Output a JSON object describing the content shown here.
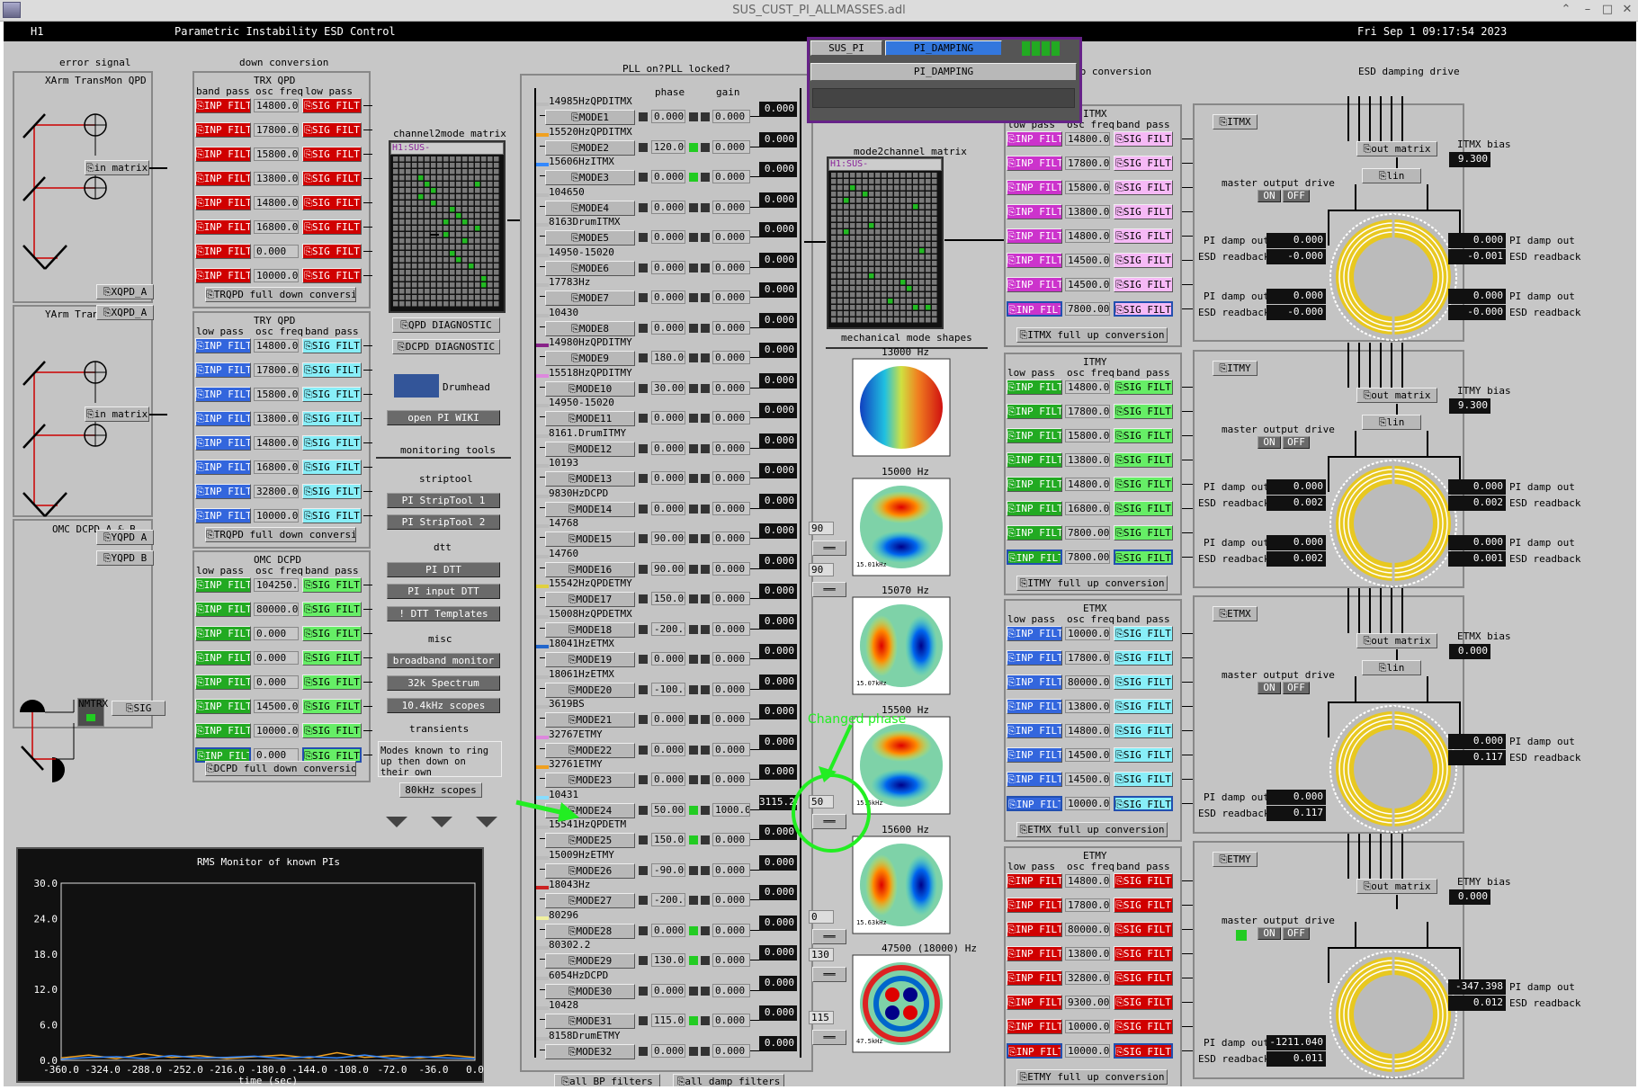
{
  "window_title": "SUS_CUST_PI_ALLMASSES.adl",
  "header": {
    "ifo": "H1",
    "title": "Parametric Instability ESD Control",
    "datetime": "Fri Sep  1 09:17:54 2023"
  },
  "colors": {
    "background": "#c7c7c7",
    "alarm_red": "#d00000",
    "damp_green": "#22aa22",
    "esd_ring": "#f0d020",
    "popup_border": "#662288",
    "annotation": "#22ee22"
  },
  "popup": {
    "tab1": "SUS_PI",
    "tab2": "PI_DAMPING",
    "menu": "PI_DAMPING"
  },
  "error_signal": {
    "title": "error signal",
    "xarm_title": "XArm TransMon QPD",
    "xarm_in_matrix": "in matrix",
    "xqpd_a": "XQPD_A",
    "xqpd_b": "XQPD_A",
    "yarm_title": "YArm TransMon QPD",
    "yarm_in_matrix": "in matrix",
    "yqpd_a": "YQPD A",
    "yqpd_b": "YQPD B",
    "omc_title": "OMC DCPD A & B",
    "nmtrx": "NMTRX",
    "sig": "SIG"
  },
  "down_conversion": {
    "title": "down conversion",
    "trx": {
      "title": "TRX QPD",
      "col_a": "band pass",
      "col_b": "osc freq",
      "col_c": "low pass",
      "inp_label": "INP FILT",
      "sig_label": "SIG FILT",
      "freqs": [
        "14800.0",
        "17800.0",
        "15800.0",
        "13800.0",
        "14800.0",
        "16800.0",
        "0.000",
        "10000.0"
      ],
      "full_label": "TRQPD full down conversion"
    },
    "try": {
      "title": "TRY QPD",
      "col_a": "low pass",
      "col_b": "osc freq",
      "col_c": "band pass",
      "inp_label": "INP FILT",
      "sig_label": "SIG FILT",
      "freqs": [
        "14800.0",
        "17800.0",
        "15800.0",
        "13800.0",
        "14800.0",
        "16800.0",
        "32800.0",
        "10000.0"
      ],
      "full_label": "TRQPD full down conversion"
    },
    "omc": {
      "title": "OMC DCPD",
      "col_a": "low pass",
      "col_b": "osc freq",
      "col_c": "band pass",
      "inp_label": "INP FILT",
      "sig_label": "SIG FILT",
      "freqs": [
        "104250.",
        "80000.0",
        "0.000",
        "0.000",
        "0.000",
        "14500.0",
        "10000.0",
        "0.000"
      ],
      "full_label": "DCPD full down conversion"
    }
  },
  "channel2mode": {
    "title": "channel2mode matrix",
    "pv": "H1:SUS-PI_PROC_CHNL2MODE_MTRX"
  },
  "tools": {
    "qpd_diag": "QPD DIAGNOSTIC",
    "dcpd_diag": "DCPD DIAGNOSTIC",
    "drumhead": "Drumhead",
    "wiki": "open PI WIKI",
    "monitoring": "monitoring tools",
    "striptool": "striptool",
    "st1": "PI StripTool 1",
    "st2": "PI StripTool 2",
    "dtt": "dtt",
    "pi_dtt": "PI DTT",
    "pi_input_dtt": "PI input DTT",
    "dtt_templates": "! DTT Templates",
    "misc": "misc",
    "broadband": "broadband monitor",
    "spectrum": "32k Spectrum",
    "scopes10": "10.4kHz scopes",
    "transients": "transients",
    "note": "Modes known to ring up then down on their own",
    "scopes80": "80kHz scopes"
  },
  "modes_header": {
    "pll_on": "PLL on?",
    "pll_locked": "PLL locked?",
    "phase": "phase",
    "gain": "gain"
  },
  "modes": [
    {
      "freq": "14985HzQPDITMX",
      "name": "MODE1",
      "phase": "0.000",
      "gain": "0.000",
      "out": "0.000",
      "color": "#bbbbbb",
      "locked": false
    },
    {
      "freq": "15520HzQPDITMX",
      "name": "MODE2",
      "phase": "120.00",
      "gain": "0.000",
      "out": "0.000",
      "color": "#f0a020",
      "locked": true
    },
    {
      "freq": "15606HzITMX",
      "name": "MODE3",
      "phase": "0.000",
      "gain": "0.000",
      "out": "0.000",
      "color": "#3388ff",
      "locked": true
    },
    {
      "freq": "104650",
      "name": "MODE4",
      "phase": "0.000",
      "gain": "0.000",
      "out": "0.000",
      "color": "#bbbbbb",
      "locked": false
    },
    {
      "freq": "8163DrumITMX",
      "name": "MODE5",
      "phase": "0.000",
      "gain": "0.000",
      "out": "0.000",
      "color": "#bbbbbb",
      "locked": false
    },
    {
      "freq": "14950-15020",
      "name": "MODE6",
      "phase": "0.000",
      "gain": "0.000",
      "out": "0.000",
      "color": "#bbbbbb",
      "locked": false
    },
    {
      "freq": "17783Hz",
      "name": "MODE7",
      "phase": "0.000",
      "gain": "0.000",
      "out": "0.000",
      "color": "#bbbbbb",
      "locked": false
    },
    {
      "freq": "10430",
      "name": "MODE8",
      "phase": "0.000",
      "gain": "0.000",
      "out": "0.000",
      "color": "#bbbbbb",
      "locked": false
    },
    {
      "freq": "14980HzQPDITMY",
      "name": "MODE9",
      "phase": "180.00",
      "gain": "0.000",
      "out": "0.000",
      "color": "#882288",
      "locked": false
    },
    {
      "freq": "15518HzQPDITMY",
      "name": "MODE10",
      "phase": "30.000",
      "gain": "0.000",
      "out": "0.000",
      "color": "#dd88dd",
      "locked": false
    },
    {
      "freq": "14950-15020",
      "name": "MODE11",
      "phase": "0.000",
      "gain": "0.000",
      "out": "0.000",
      "color": "#bbbbbb",
      "locked": false
    },
    {
      "freq": "8161.DrumITMY",
      "name": "MODE12",
      "phase": "0.000",
      "gain": "0.000",
      "out": "0.000",
      "color": "#bbbbbb",
      "locked": false
    },
    {
      "freq": "10193",
      "name": "MODE13",
      "phase": "0.000",
      "gain": "0.000",
      "out": "0.000",
      "color": "#bbbbbb",
      "locked": false
    },
    {
      "freq": "9830HzDCPD",
      "name": "MODE14",
      "phase": "0.000",
      "gain": "0.000",
      "out": "0.000",
      "color": "#bbbbbb",
      "locked": false
    },
    {
      "freq": "14768",
      "name": "MODE15",
      "phase": "90.000",
      "gain": "0.000",
      "out": "0.000",
      "color": "#bbbbbb",
      "locked": false
    },
    {
      "freq": "14760",
      "name": "MODE16",
      "phase": "90.000",
      "gain": "0.000",
      "out": "0.000",
      "color": "#bbbbbb",
      "locked": false
    },
    {
      "freq": "15542HzQPDETMY",
      "name": "MODE17",
      "phase": "150.00",
      "gain": "0.000",
      "out": "0.000",
      "color": "#e0d040",
      "locked": false
    },
    {
      "freq": "15008HzQPDETMX",
      "name": "MODE18",
      "phase": "-200.0",
      "gain": "0.000",
      "out": "0.000",
      "color": "#bbbbbb",
      "locked": false
    },
    {
      "freq": "18041HzETMX",
      "name": "MODE19",
      "phase": "0.000",
      "gain": "0.000",
      "out": "0.000",
      "color": "#2266cc",
      "locked": false
    },
    {
      "freq": "18061HzETMX",
      "name": "MODE20",
      "phase": "-100.0",
      "gain": "0.000",
      "out": "0.000",
      "color": "#bbbbbb",
      "locked": false
    },
    {
      "freq": "3619BS",
      "name": "MODE21",
      "phase": "0.000",
      "gain": "0.000",
      "out": "0.000",
      "color": "#bbbbbb",
      "locked": false
    },
    {
      "freq": "32767ETMY",
      "name": "MODE22",
      "phase": "0.000",
      "gain": "0.000",
      "out": "0.000",
      "color": "#dd88dd",
      "locked": false
    },
    {
      "freq": "32761ETMY",
      "name": "MODE23",
      "phase": "0.000",
      "gain": "0.000",
      "out": "0.000",
      "color": "#f0a020",
      "locked": false
    },
    {
      "freq": "10431",
      "name": "MODE24",
      "phase": "50.000",
      "gain": "1000.00",
      "out": "3115.22",
      "color": "#88ddff",
      "locked": true
    },
    {
      "freq": "15541HzQPDETM",
      "name": "MODE25",
      "phase": "150.00",
      "gain": "0.000",
      "out": "0.000",
      "color": "#bbbbbb",
      "locked": true
    },
    {
      "freq": "15009HzETMY",
      "name": "MODE26",
      "phase": "-90.000",
      "gain": "0.000",
      "out": "0.000",
      "color": "#bbbbbb",
      "locked": false
    },
    {
      "freq": "18043Hz",
      "name": "MODE27",
      "phase": "-200.0",
      "gain": "0.000",
      "out": "0.000",
      "color": "#cc2222",
      "locked": false
    },
    {
      "freq": "80296",
      "name": "MODE28",
      "phase": "0.000",
      "gain": "0.000",
      "out": "0.000",
      "color": "#f0f0a0",
      "locked": true
    },
    {
      "freq": "80302.2",
      "name": "MODE29",
      "phase": "130.00",
      "gain": "0.000",
      "out": "0.000",
      "color": "#bbbbbb",
      "locked": true
    },
    {
      "freq": "6054HzDCPD",
      "name": "MODE30",
      "phase": "0.000",
      "gain": "0.000",
      "out": "0.000",
      "color": "#bbbbbb",
      "locked": false
    },
    {
      "freq": "10428",
      "name": "MODE31",
      "phase": "115.00",
      "gain": "0.000",
      "out": "0.000",
      "color": "#bbbbbb",
      "locked": true
    },
    {
      "freq": "8158DrumETMY",
      "name": "MODE32",
      "phase": "0.000",
      "gain": "0.000",
      "out": "0.000",
      "color": "#bbbbbb",
      "locked": false
    }
  ],
  "mode_footer": {
    "all_bp": "all BP filters",
    "all_damp": "all damp filters"
  },
  "mode2channel": {
    "title": "mode2channel matrix",
    "pv": "H1:SUS-PI_PROC_MODE2CHNL_MTRX"
  },
  "mechanical": {
    "title": "mechanical mode shapes",
    "shapes": [
      {
        "label": "13000 Hz",
        "caption": ""
      },
      {
        "label": "15000 Hz",
        "caption": "15.01kHz"
      },
      {
        "label": "15070 Hz",
        "caption": "15.07kHz"
      },
      {
        "label": "15500 Hz",
        "caption": "15.5kHz"
      },
      {
        "label": "15600 Hz",
        "caption": "15.63kHz"
      },
      {
        "label": "47500 (18000) Hz",
        "caption": "47.5kHz"
      }
    ],
    "entries": [
      "90",
      "90",
      "50",
      "0",
      "130",
      "115"
    ]
  },
  "annotation": {
    "text": "Changed phase"
  },
  "up_conversion": {
    "title": "up conversion",
    "itmx": {
      "title": "ITMX",
      "col_a": "low pass",
      "col_b": "osc freq",
      "col_c": "band pass",
      "inp_label": "INP FILT",
      "sig_label": "SIG FILT",
      "freqs": [
        "14800.0",
        "17800.0",
        "15800.0",
        "13800.0",
        "14800.0",
        "14500.0",
        "14500.0",
        "7800.00"
      ],
      "full_label": "ITMX full up conversion"
    },
    "itmy": {
      "title": "ITMY",
      "col_a": "low pass",
      "col_b": "osc freq",
      "col_c": "band pass",
      "inp_label": "INP FILT",
      "sig_label": "SIG FILT",
      "freqs": [
        "14800.0",
        "17800.0",
        "15800.0",
        "13800.0",
        "14800.0",
        "16800.0",
        "7800.00",
        "7800.00"
      ],
      "full_label": "ITMY full up conversion"
    },
    "etmx": {
      "title": "ETMX",
      "col_a": "low pass",
      "col_b": "osc freq",
      "col_c": "band pass",
      "inp_label": "INP FILT",
      "sig_label": "SIG FILT",
      "freqs": [
        "10000.0",
        "17800.0",
        "80000.0",
        "13800.0",
        "14800.0",
        "14500.0",
        "14500.0",
        "10000.0"
      ],
      "full_label": "ETMX full up conversion"
    },
    "etmy": {
      "title": "ETMY",
      "col_a": "low pass",
      "col_b": "osc freq",
      "col_c": "band pass",
      "inp_label": "INP FILT",
      "sig_label": "SIG FILT",
      "freqs": [
        "14800.0",
        "17800.0",
        "80000.0",
        "13800.0",
        "32800.0",
        "9300.00",
        "10000.0",
        "10000.0"
      ],
      "full_label": "ETMY full up conversion"
    }
  },
  "esd": {
    "title": "ESD damping drive",
    "master": "master output drive",
    "on": "ON",
    "off": "OFF",
    "out_matrix": "out matrix",
    "lin": "lin",
    "damp_out_label": "PI damp out",
    "readback_label": "ESD readback",
    "itmx": {
      "name": "ITMX",
      "bias_label": "ITMX bias",
      "bias": "9.300",
      "l1_damp": "0.000",
      "l1_rb": "-0.000",
      "r1_damp": "0.000",
      "r1_rb": "-0.001",
      "l2_damp": "0.000",
      "l2_rb": "-0.000",
      "r2_damp": "0.000",
      "r2_rb": "-0.000"
    },
    "itmy": {
      "name": "ITMY",
      "bias_label": "ITMY bias",
      "bias": "9.300",
      "l1_damp": "0.000",
      "l1_rb": "0.002",
      "r1_damp": "0.000",
      "r1_rb": "0.002",
      "l2_damp": "0.000",
      "l2_rb": "0.002",
      "r2_damp": "0.000",
      "r2_rb": "0.001"
    },
    "etmx": {
      "name": "ETMX",
      "bias_label": "ETMX bias",
      "bias": "0.000",
      "r1_damp": "0.000",
      "r1_rb": "0.117",
      "l2_damp": "0.000",
      "l2_rb": "0.117"
    },
    "etmy": {
      "name": "ETMY",
      "bias_label": "ETMY bias",
      "bias": "0.000",
      "r1_damp": "-347.398",
      "r1_rb": "0.012",
      "l2_damp": "-1211.040",
      "l2_rb": "0.011"
    }
  },
  "rms": {
    "title": "RMS Monitor of known PIs",
    "xlabel": "time (sec)",
    "yticks": [
      "30.0",
      "24.0",
      "18.0",
      "12.0",
      "6.0",
      "0.0"
    ],
    "xticks": [
      "-360.0",
      "-324.0",
      "-288.0",
      "-252.0",
      "-216.0",
      "-180.0",
      "-144.0",
      "-108.0",
      "-72.0",
      "-36.0",
      "0.0"
    ]
  },
  "chart_data": {
    "type": "line",
    "title": "RMS Monitor of known PIs",
    "xlabel": "time (sec)",
    "ylabel": "",
    "xlim": [
      -360,
      0
    ],
    "ylim": [
      0,
      30
    ],
    "x": [
      -360,
      -336,
      -312,
      -288,
      -264,
      -240,
      -216,
      -192,
      -168,
      -144,
      -120,
      -96,
      -72,
      -48,
      -24,
      0
    ],
    "series": [
      {
        "values": [
          0.4,
          0.9,
          0.3,
          1.1,
          0.5,
          0.8,
          0.3,
          0.6,
          0.9,
          0.4,
          1.3,
          0.5,
          0.8,
          0.4,
          0.9,
          0.5
        ],
        "color": "#f0a020"
      },
      {
        "values": [
          0.2,
          0.5,
          0.6,
          0.3,
          0.8,
          0.4,
          0.5,
          0.7,
          0.3,
          0.6,
          0.4,
          0.9,
          0.3,
          0.6,
          0.4,
          0.3
        ],
        "color": "#3388ff"
      }
    ],
    "grid": false
  }
}
